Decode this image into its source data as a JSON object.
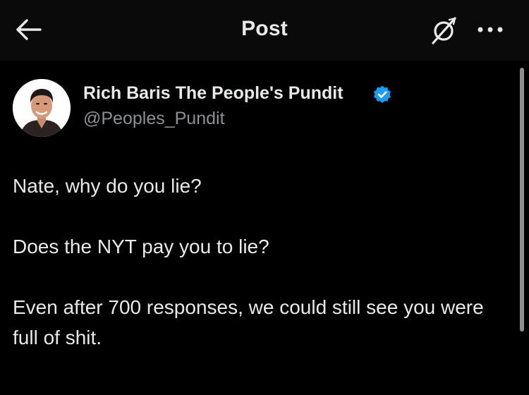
{
  "header": {
    "title": "Post",
    "back_icon": "arrow-left-icon",
    "grok_icon": "grok-slash-icon",
    "more_icon": "more-horizontal-icon"
  },
  "author": {
    "display_name": "Rich Baris The People's Pundit",
    "handle": "@Peoples_Pundit",
    "verified": true,
    "verified_color": "#1d9bf0"
  },
  "post": {
    "paragraphs": [
      "Nate, why do you lie?",
      "Does the NYT pay you to lie?",
      "Even after 700 responses, we could still see you were full of shit."
    ]
  },
  "colors": {
    "background": "#000000",
    "text": "#e7e9ea",
    "secondary_text": "#8b8f94",
    "accent": "#1d9bf0"
  }
}
